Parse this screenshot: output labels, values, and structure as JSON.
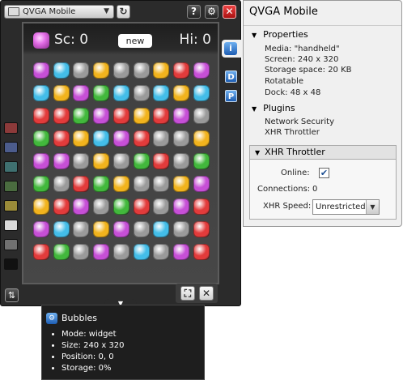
{
  "emulator": {
    "device_select": {
      "value": "QVGA Mobile",
      "arrow": "▼"
    },
    "buttons": {
      "refresh": "↻",
      "help": "?",
      "settings": "⚙",
      "close": "✕"
    }
  },
  "game": {
    "score": "Sc: 0",
    "new_label": "new",
    "high_score": "Hi: 0",
    "gem_colors": {
      "P": "#c64fd6",
      "C": "#43bde8",
      "S": "#9a9a9a",
      "Y": "#f1b31d",
      "R": "#e23b3b",
      "G": "#42b83c"
    },
    "board": [
      [
        "P",
        "C",
        "S",
        "Y",
        "S",
        "S",
        "Y",
        "R",
        "P"
      ],
      [
        "C",
        "Y",
        "P",
        "G",
        "C",
        "S",
        "C",
        "Y",
        "C"
      ],
      [
        "R",
        "R",
        "G",
        "P",
        "R",
        "Y",
        "R",
        "P",
        "S"
      ],
      [
        "G",
        "R",
        "Y",
        "C",
        "P",
        "R",
        "S",
        "S",
        "Y"
      ],
      [
        "P",
        "P",
        "S",
        "Y",
        "S",
        "G",
        "R",
        "S",
        "G"
      ],
      [
        "G",
        "S",
        "R",
        "G",
        "Y",
        "S",
        "S",
        "Y",
        "P"
      ],
      [
        "Y",
        "R",
        "P",
        "S",
        "G",
        "R",
        "S",
        "P",
        "R"
      ],
      [
        "P",
        "C",
        "S",
        "Y",
        "P",
        "S",
        "C",
        "S",
        "R"
      ],
      [
        "R",
        "G",
        "S",
        "P",
        "S",
        "C",
        "S",
        "P",
        "R"
      ]
    ]
  },
  "swatch_colors": [
    "#8c3a3a",
    "#4c5c8c",
    "#3f7070",
    "#4a6b3f",
    "#9a8b39",
    "#d9d9d9",
    "#707070",
    "#111111"
  ],
  "side_buttons": {
    "info": "i",
    "d": "D",
    "p": "P"
  },
  "bottom_buttons": {
    "fit": "⛶",
    "close": "✕",
    "expand": "▼",
    "rotate": "⇅"
  },
  "info_panel": {
    "title": "QVGA Mobile",
    "properties_head": "Properties",
    "properties": [
      "Media: \"handheld\"",
      "Screen: 240 x 320",
      "Storage space: 20 KB",
      "Rotatable",
      "Dock: 48 x 48"
    ],
    "plugins_head": "Plugins",
    "plugins": [
      "Network Security",
      "XHR Throttler"
    ],
    "xhr": {
      "head": "XHR Throttler",
      "online_label": "Online:",
      "online_checked": "✔",
      "connections_label": "Connections:",
      "connections_value": "0",
      "speed_label": "XHR Speed:",
      "speed_value": "Unrestricted",
      "speed_arrow": "▼"
    }
  },
  "bubbles": {
    "icon": "⚙",
    "title": "Bubbles",
    "items": [
      "Mode: widget",
      "Size: 240 x 320",
      "Position: 0, 0",
      "Storage: 0%"
    ]
  }
}
